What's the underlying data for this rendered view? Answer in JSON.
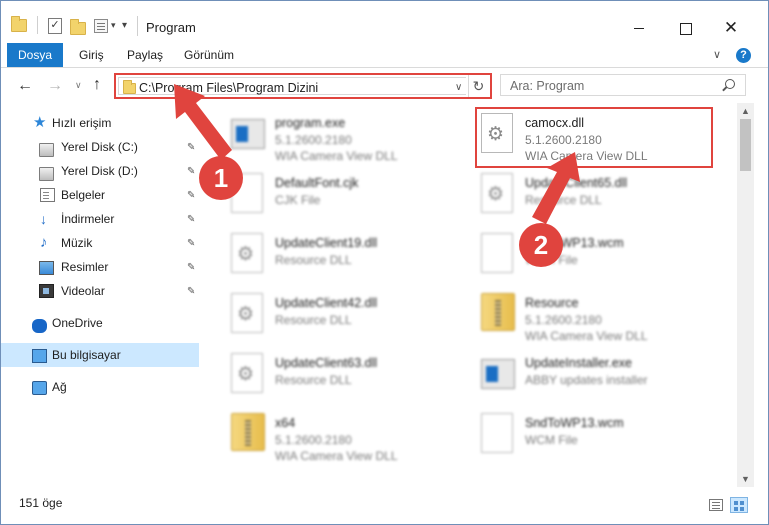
{
  "window": {
    "title": "Program",
    "quick_access_dropdown": "▾",
    "min_label": "",
    "max_label": "",
    "close_label": "✕"
  },
  "ribbon": {
    "tabs": [
      "Dosya",
      "Giriş",
      "Paylaş",
      "Görünüm"
    ],
    "expand_label": "∨",
    "help_label": "?"
  },
  "nav": {
    "back_label": "←",
    "forward_label": "→",
    "recent_label": "∨",
    "up_label": "↑",
    "address": "C:\\Program Files\\Program Dizini",
    "address_dropdown": "∨",
    "refresh_label": "↻",
    "search_placeholder": "Ara: Program"
  },
  "sidebar": {
    "items": [
      {
        "label": "Hızlı erişim",
        "icon": "star-icon"
      },
      {
        "label": "Yerel Disk (C:)",
        "icon": "drive-icon"
      },
      {
        "label": "Yerel Disk (D:)",
        "icon": "drive-icon"
      },
      {
        "label": "Belgeler",
        "icon": "documents-icon"
      },
      {
        "label": "İndirmeler",
        "icon": "download-icon"
      },
      {
        "label": "Müzik",
        "icon": "music-icon"
      },
      {
        "label": "Resimler",
        "icon": "pictures-icon"
      },
      {
        "label": "Videolar",
        "icon": "videos-icon"
      },
      {
        "label": "OneDrive",
        "icon": "onedrive-icon"
      },
      {
        "label": "Bu bilgisayar",
        "icon": "pc-icon"
      },
      {
        "label": "Ağ",
        "icon": "network-icon"
      }
    ],
    "pin_glyph": "📌"
  },
  "files": [
    {
      "name": "program.exe",
      "line2": "5.1.2600.2180",
      "line3": "WIA Camera View DLL"
    },
    {
      "name": "camocx.dll",
      "line2": "5.1.2600.2180",
      "line3": "WIA Camera View DLL"
    },
    {
      "name": "DefaultFont.cjk",
      "line2": "CJK File",
      "line3": ""
    },
    {
      "name": "UpdateClient65.dll",
      "line2": "Resource DLL",
      "line3": ""
    },
    {
      "name": "UpdateClient19.dll",
      "line2": "Resource DLL",
      "line3": ""
    },
    {
      "name": "SndToWP13.wcm",
      "line2": "WCM File",
      "line3": ""
    },
    {
      "name": "UpdateClient42.dll",
      "line2": "Resource DLL",
      "line3": ""
    },
    {
      "name": "Resource",
      "line2": "5.1.2600.2180",
      "line3": "WIA Camera View DLL"
    },
    {
      "name": "UpdateClient63.dll",
      "line2": "Resource DLL",
      "line3": ""
    },
    {
      "name": "UpdateInstaller.exe",
      "line2": "ABBY updates installer",
      "line3": ""
    },
    {
      "name": "x64",
      "line2": "5.1.2600.2180",
      "line3": "WIA Camera View DLL"
    },
    {
      "name": "SndToWP13.wcm",
      "line2": "WCM File",
      "line3": ""
    }
  ],
  "status": {
    "count": "151 öge"
  },
  "annotations": {
    "badge1": "1",
    "badge2": "2",
    "accent": "#e0443e"
  },
  "colors": {
    "file_tab": "#1979ca",
    "selection": "#cce8ff"
  }
}
